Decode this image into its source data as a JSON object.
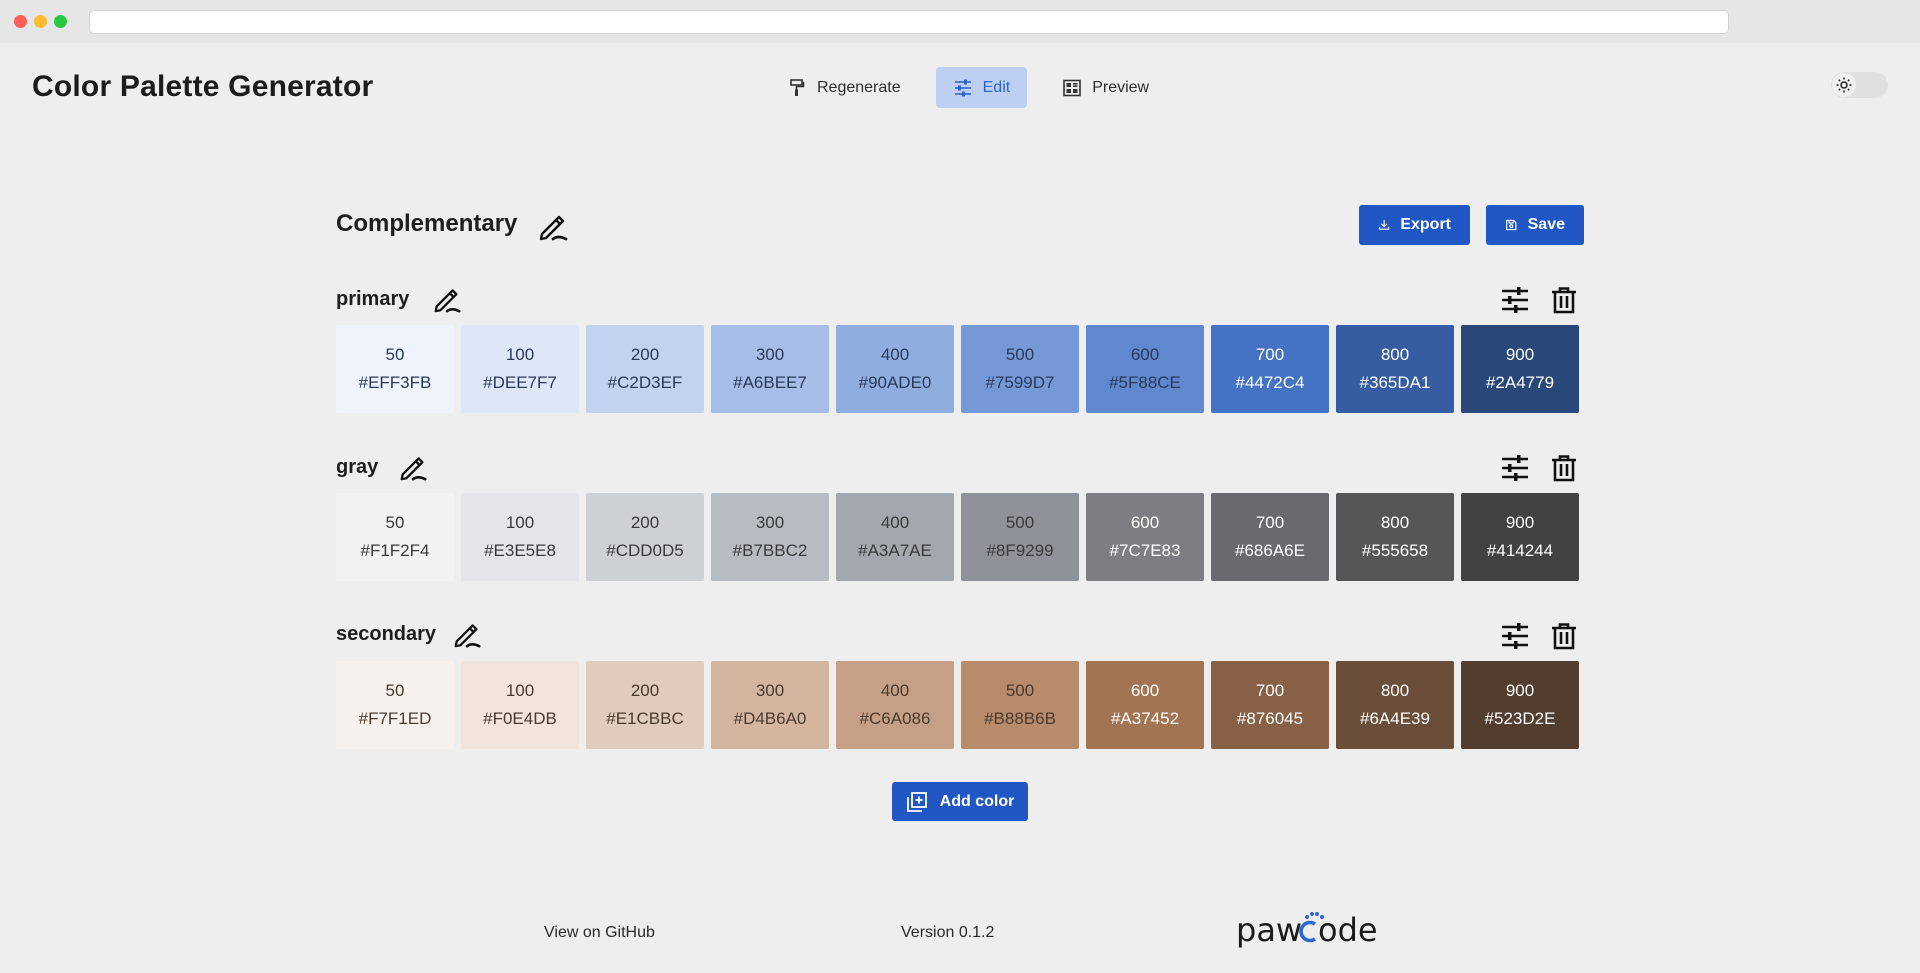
{
  "app": {
    "title": "Color Palette Generator"
  },
  "nav": [
    {
      "label": "Regenerate",
      "icon": "paint-roller-icon",
      "active": false
    },
    {
      "label": "Edit",
      "icon": "sliders-icon",
      "active": true
    },
    {
      "label": "Preview",
      "icon": "layout-icon",
      "active": false
    }
  ],
  "palette": {
    "name": "Complementary",
    "export_label": "Export",
    "save_label": "Save",
    "add_label": "Add color",
    "groups": [
      {
        "name": "primary",
        "swatches": [
          {
            "shade": "50",
            "hex": "#EFF3FB",
            "text": "#2a3a5a"
          },
          {
            "shade": "100",
            "hex": "#DEE7F7",
            "text": "#2a3a5a"
          },
          {
            "shade": "200",
            "hex": "#C2D3EF",
            "text": "#2a3a5a"
          },
          {
            "shade": "300",
            "hex": "#A6BEE7",
            "text": "#2a3a5a"
          },
          {
            "shade": "400",
            "hex": "#90ADE0",
            "text": "#2a3a5a"
          },
          {
            "shade": "500",
            "hex": "#7599D7",
            "text": "#2a3a5a"
          },
          {
            "shade": "600",
            "hex": "#5F88CE",
            "text": "#2a3a5a"
          },
          {
            "shade": "700",
            "hex": "#4472C4",
            "text": "#ffffff"
          },
          {
            "shade": "800",
            "hex": "#365DA1",
            "text": "#ffffff"
          },
          {
            "shade": "900",
            "hex": "#2A4779",
            "text": "#ffffff"
          }
        ]
      },
      {
        "name": "gray",
        "swatches": [
          {
            "shade": "50",
            "hex": "#F1F2F4",
            "text": "#3a3a3a"
          },
          {
            "shade": "100",
            "hex": "#E3E5E8",
            "text": "#3a3a3a"
          },
          {
            "shade": "200",
            "hex": "#CDD0D5",
            "text": "#3a3a3a"
          },
          {
            "shade": "300",
            "hex": "#B7BBC2",
            "text": "#3a3a3a"
          },
          {
            "shade": "400",
            "hex": "#A3A7AE",
            "text": "#3a3a3a"
          },
          {
            "shade": "500",
            "hex": "#8F9299",
            "text": "#3a3a3a"
          },
          {
            "shade": "600",
            "hex": "#7C7E83",
            "text": "#ffffff"
          },
          {
            "shade": "700",
            "hex": "#686A6E",
            "text": "#ffffff"
          },
          {
            "shade": "800",
            "hex": "#555658",
            "text": "#ffffff"
          },
          {
            "shade": "900",
            "hex": "#414244",
            "text": "#ffffff"
          }
        ]
      },
      {
        "name": "secondary",
        "swatches": [
          {
            "shade": "50",
            "hex": "#F7F1ED",
            "text": "#4a3a2e"
          },
          {
            "shade": "100",
            "hex": "#F0E4DB",
            "text": "#4a3a2e"
          },
          {
            "shade": "200",
            "hex": "#E1CBBC",
            "text": "#4a3a2e"
          },
          {
            "shade": "300",
            "hex": "#D4B6A0",
            "text": "#4a3a2e"
          },
          {
            "shade": "400",
            "hex": "#C6A086",
            "text": "#4a3a2e"
          },
          {
            "shade": "500",
            "hex": "#B88B6B",
            "text": "#4a3a2e"
          },
          {
            "shade": "600",
            "hex": "#A37452",
            "text": "#ffffff"
          },
          {
            "shade": "700",
            "hex": "#876045",
            "text": "#ffffff"
          },
          {
            "shade": "800",
            "hex": "#6A4E39",
            "text": "#ffffff"
          },
          {
            "shade": "900",
            "hex": "#523D2E",
            "text": "#ffffff"
          }
        ]
      }
    ]
  },
  "footer": {
    "github_label": "View on GitHub",
    "version": "Version 0.1.2",
    "logo_text": "pawcode"
  },
  "colors": {
    "accent": "#2157C4",
    "nav_active_bg": "#BDCFF2",
    "background": "#EFEEEE"
  }
}
